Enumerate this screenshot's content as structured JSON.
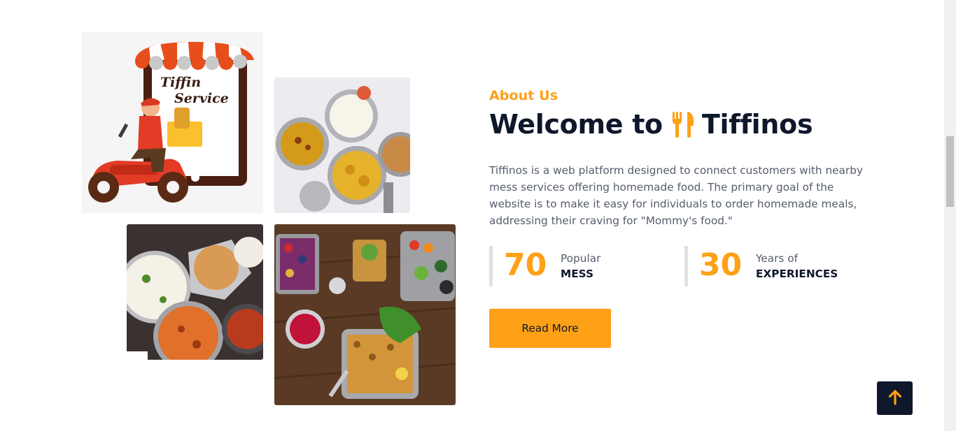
{
  "about": {
    "eyebrow": "About Us",
    "title_prefix": "Welcome to",
    "title_brand": "Tiffinos",
    "title_icon": "utensils-icon",
    "description": "Tiffinos is a web platform designed to connect customers with nearby mess services offering homemade food. The primary goal of the website is to make it easy for individuals to order homemade meals, addressing their craving for \"Mommy's food.\"",
    "stats": [
      {
        "number": "70",
        "label_top": "Popular",
        "label_bottom": "MESS"
      },
      {
        "number": "30",
        "label_top": "Years of",
        "label_bottom": "EXPERIENCES"
      }
    ],
    "cta_label": "Read More"
  },
  "images": {
    "logo_text_line1": "Tiffin",
    "logo_text_line2": "Service"
  },
  "back_to_top_icon": "arrow-up-icon",
  "colors": {
    "accent": "#fea116",
    "dark": "#0f172b",
    "body_text": "#555c6b"
  }
}
